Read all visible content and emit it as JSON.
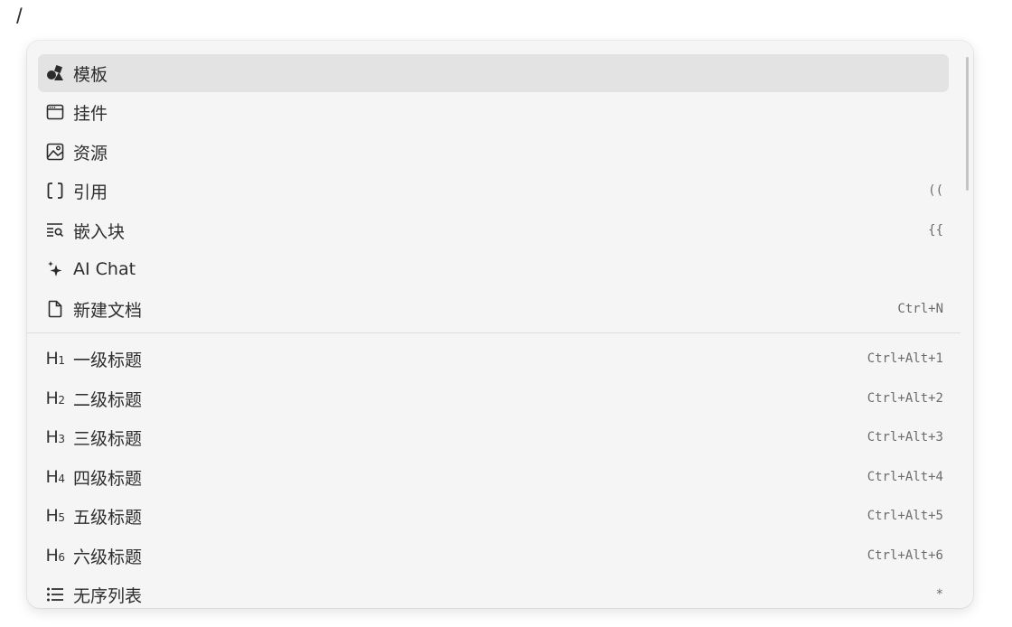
{
  "editor": {
    "trigger_text": "/"
  },
  "menu": {
    "group1": [
      {
        "icon": "template-icon",
        "label": "模板",
        "shortcut": "",
        "active": true
      },
      {
        "icon": "widget-icon",
        "label": "挂件",
        "shortcut": ""
      },
      {
        "icon": "image-icon",
        "label": "资源",
        "shortcut": ""
      },
      {
        "icon": "brackets-icon",
        "label": "引用",
        "shortcut": "(("
      },
      {
        "icon": "embed-search-icon",
        "label": "嵌入块",
        "shortcut": "{{"
      },
      {
        "icon": "sparkle-icon",
        "label": "AI Chat",
        "shortcut": ""
      },
      {
        "icon": "file-icon",
        "label": "新建文档",
        "shortcut": "Ctrl+N"
      }
    ],
    "group2": [
      {
        "icon": "heading-1-icon",
        "tag": "H",
        "level": "1",
        "label": "一级标题",
        "shortcut": "Ctrl+Alt+1"
      },
      {
        "icon": "heading-2-icon",
        "tag": "H",
        "level": "2",
        "label": "二级标题",
        "shortcut": "Ctrl+Alt+2"
      },
      {
        "icon": "heading-3-icon",
        "tag": "H",
        "level": "3",
        "label": "三级标题",
        "shortcut": "Ctrl+Alt+3"
      },
      {
        "icon": "heading-4-icon",
        "tag": "H",
        "level": "4",
        "label": "四级标题",
        "shortcut": "Ctrl+Alt+4"
      },
      {
        "icon": "heading-5-icon",
        "tag": "H",
        "level": "5",
        "label": "五级标题",
        "shortcut": "Ctrl+Alt+5"
      },
      {
        "icon": "heading-6-icon",
        "tag": "H",
        "level": "6",
        "label": "六级标题",
        "shortcut": "Ctrl+Alt+6"
      },
      {
        "icon": "bullet-list-icon",
        "label": "无序列表",
        "shortcut": "*"
      }
    ]
  },
  "colors": {
    "menu_bg": "#f5f5f5",
    "active_bg": "#e3e3e3",
    "text": "#2e2e2e",
    "shortcut_text": "#6b6b6b"
  }
}
